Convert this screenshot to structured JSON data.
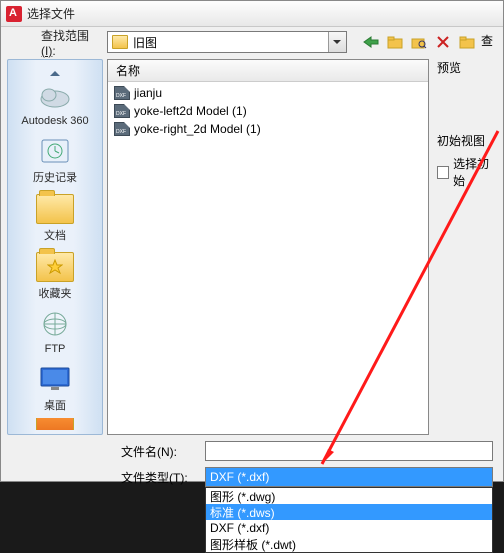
{
  "title": "选择文件",
  "toolbar": {
    "look_in_label": "查找范围",
    "look_in_acc": "(I)",
    "colon": ":",
    "current_folder": "旧图",
    "search_btn": "查"
  },
  "sidebar": {
    "items": [
      {
        "label": "Autodesk 360"
      },
      {
        "label": "历史记录"
      },
      {
        "label": "文档"
      },
      {
        "label": "收藏夹"
      },
      {
        "label": "FTP"
      },
      {
        "label": "桌面"
      }
    ]
  },
  "filelist": {
    "header": "名称",
    "files": [
      {
        "name": "jianju"
      },
      {
        "name": "yoke-left2d Model (1)"
      },
      {
        "name": "yoke-right_2d Model (1)"
      }
    ]
  },
  "rightpane": {
    "preview_label": "预览",
    "initview_label": "初始视图",
    "initview_checkbox": "选择初始"
  },
  "bottom": {
    "filename_label": "文件名(N):",
    "filename_value": "",
    "filetype_label": "文件类型(T):",
    "filetype_selected": "DXF (*.dxf)",
    "options": [
      {
        "text": "图形 (*.dwg)",
        "hl": false
      },
      {
        "text": "标准 (*.dws)",
        "hl": true
      },
      {
        "text": "DXF (*.dxf)",
        "hl": false
      },
      {
        "text": "图形样板 (*.dwt)",
        "hl": false
      }
    ]
  }
}
